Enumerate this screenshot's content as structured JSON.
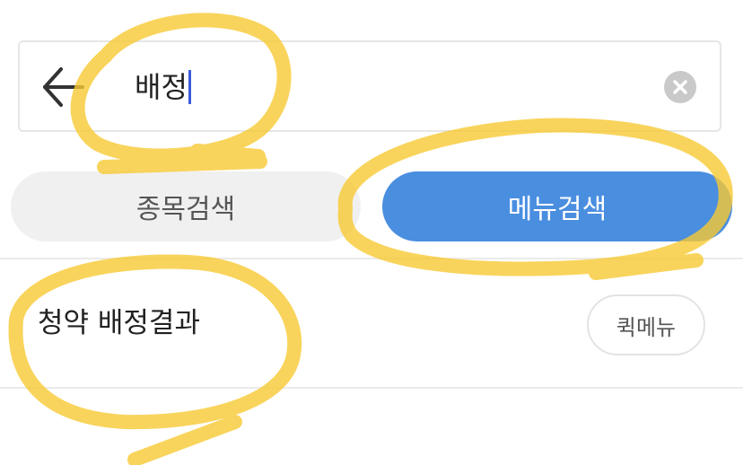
{
  "search": {
    "query": "배정",
    "back_icon": "arrow-left-icon",
    "clear_icon": "clear-circle-icon"
  },
  "tabs": {
    "stock_search": "종목검색",
    "menu_search": "메뉴검색",
    "active": "menu_search",
    "active_color": "#4a8ee0"
  },
  "results": [
    {
      "title": "청약 배정결과",
      "quick_menu_label": "퀵메뉴"
    }
  ],
  "annotation": {
    "highlight_color": "#f7c933"
  }
}
